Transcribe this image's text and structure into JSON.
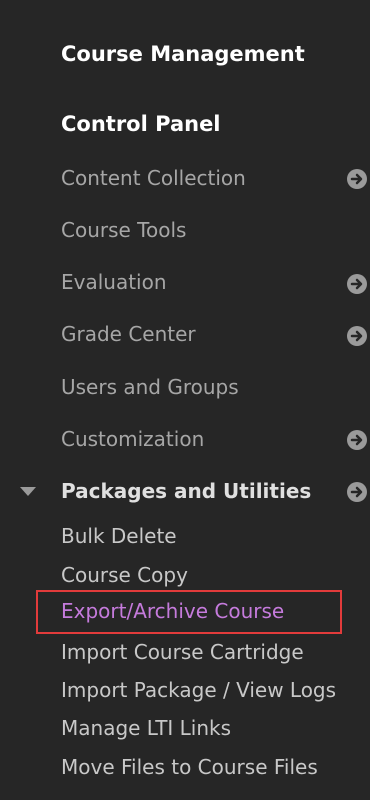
{
  "sidebar": {
    "section_title": "Course Management",
    "panel_title": "Control Panel",
    "items": [
      {
        "label": "Content Collection",
        "has_arrow": true
      },
      {
        "label": "Course Tools",
        "has_arrow": false
      },
      {
        "label": "Evaluation",
        "has_arrow": true
      },
      {
        "label": "Grade Center",
        "has_arrow": true
      },
      {
        "label": "Users and Groups",
        "has_arrow": false
      },
      {
        "label": "Customization",
        "has_arrow": true
      },
      {
        "label": "Packages and Utilities",
        "has_arrow": true,
        "expanded": true
      }
    ],
    "sub_items": [
      {
        "label": "Bulk Delete"
      },
      {
        "label": "Course Copy"
      },
      {
        "label": "Export/Archive Course",
        "active": true
      },
      {
        "label": "Import Course Cartridge"
      },
      {
        "label": "Import Package / View Logs"
      },
      {
        "label": "Manage LTI Links"
      },
      {
        "label": "Move Files to Course Files"
      }
    ]
  },
  "colors": {
    "panel_bg": "#262626",
    "active_link": "#c57bdc",
    "highlight_border": "#e23b3b"
  },
  "icons": {
    "expand_arrow": "arrow-right-circle-icon",
    "collapse_toggle": "triangle-down-icon"
  }
}
